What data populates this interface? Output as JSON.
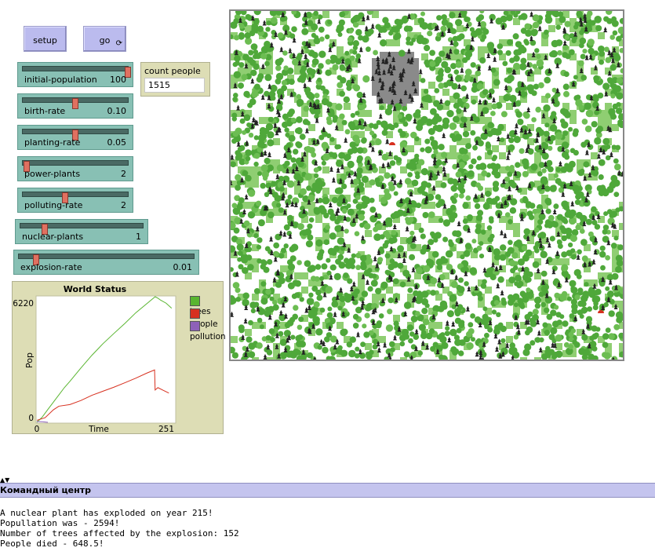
{
  "buttons": {
    "setup": "setup",
    "go": "go",
    "go_forever_icon": "forever-arrows-icon",
    "go_forever_glyph": "⟳"
  },
  "sliders": [
    {
      "name": "initial-population",
      "value": "100",
      "fraction": 1.0
    },
    {
      "name": "birth-rate",
      "value": "0.10",
      "fraction": 0.5
    },
    {
      "name": "planting-rate",
      "value": "0.05",
      "fraction": 0.5
    },
    {
      "name": "power-plants",
      "value": "2",
      "fraction": 0.04
    },
    {
      "name": "polluting-rate",
      "value": "2",
      "fraction": 0.4
    },
    {
      "name": "nuclear-plants",
      "value": "1",
      "fraction": 0.2
    },
    {
      "name": "explosion-rate",
      "value": "0.01",
      "fraction": 0.1
    }
  ],
  "monitor": {
    "label": "count people",
    "value": "1515"
  },
  "plot": {
    "title": "World Status",
    "ylabel": "Pop",
    "xlabel": "Time",
    "ymax_label": "6220",
    "ymin_label": "0",
    "xmin_label": "0",
    "xmax_label": "251",
    "legend": [
      {
        "name": "trees",
        "color": "#59b530"
      },
      {
        "name": "people",
        "color": "#d7301f"
      },
      {
        "name": "pollution",
        "color": "#8e61b8"
      }
    ]
  },
  "chart_data": {
    "type": "line",
    "xlim": [
      0,
      251
    ],
    "ylim": [
      0,
      6220
    ],
    "series": [
      {
        "name": "trees",
        "color": "#59b530",
        "x": [
          0,
          10,
          20,
          30,
          40,
          50,
          60,
          80,
          100,
          120,
          140,
          160,
          180,
          200,
          215,
          220,
          225,
          235,
          245
        ],
        "y": [
          0,
          270,
          640,
          1000,
          1360,
          1720,
          2030,
          2690,
          3320,
          3890,
          4400,
          4900,
          5430,
          5880,
          6220,
          6150,
          6050,
          5900,
          5650
        ]
      },
      {
        "name": "people",
        "color": "#d7301f",
        "x": [
          0,
          15,
          30,
          40,
          60,
          80,
          100,
          120,
          140,
          160,
          180,
          200,
          214,
          215,
          220,
          230,
          240
        ],
        "y": [
          100,
          230,
          620,
          800,
          880,
          1080,
          1340,
          1540,
          1740,
          1960,
          2190,
          2440,
          2594,
          1600,
          1720,
          1580,
          1450
        ]
      },
      {
        "name": "pollution",
        "color": "#8e61b8",
        "x": [
          0,
          10,
          20
        ],
        "y": [
          40,
          30,
          0
        ]
      }
    ]
  },
  "command_center": {
    "title": "Командный центр",
    "grip": "▲▼",
    "lines": [
      "A nuclear plant has exploded on year 215!",
      "Popullation was - 2594!",
      "Number of trees affected by the explosion: 152",
      "People died - 648.5!"
    ]
  },
  "colors": {
    "button": "#bbbbee",
    "slider": "#88c0b4",
    "monitor": "#ddddb5",
    "tree_dark": "#4fa83a",
    "tree_light": "#8fce72",
    "stump": "#222222",
    "patch_gray": "#8a8a8a",
    "nuclear_plant": "#d7301f"
  },
  "world": {
    "tree_icon": "tree-icon",
    "dead_tree_icon": "dead-tree-icon",
    "plant_icon": "nuclear-plant-icon"
  }
}
